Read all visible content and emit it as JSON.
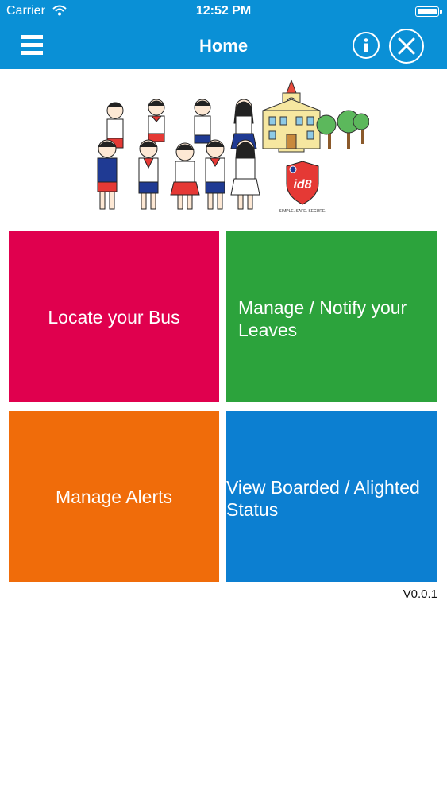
{
  "status_bar": {
    "carrier": "Carrier",
    "time": "12:52 PM"
  },
  "nav": {
    "title": "Home",
    "left_icon": "hamburger-menu-icon",
    "right_icons": [
      "info-icon",
      "close-icon"
    ]
  },
  "banner": {
    "logo_text": "id8",
    "tagline": "SIMPLE. SAFE. SECURE."
  },
  "tiles": [
    {
      "label": "Locate your Bus",
      "color": "#e0004e"
    },
    {
      "label": "Manage / Notify your Leaves",
      "color": "#2ca33c"
    },
    {
      "label": "Manage Alerts",
      "color": "#f06c0a"
    },
    {
      "label": "View Boarded / Alighted Status",
      "color": "#0c7fd1"
    }
  ],
  "version": "V0.0.1",
  "colors": {
    "nav_background": "#0a90d6"
  }
}
